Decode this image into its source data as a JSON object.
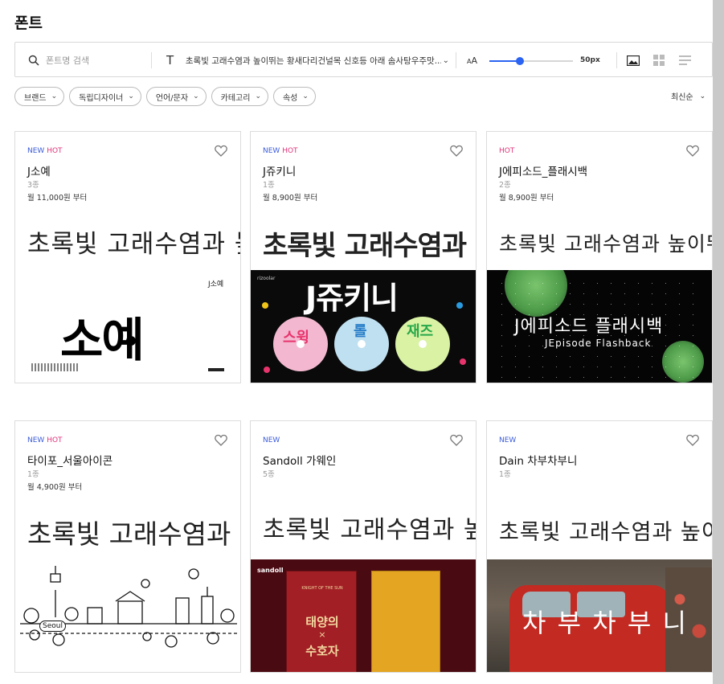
{
  "page": {
    "title": "폰트"
  },
  "search": {
    "placeholder": "폰트명 검색",
    "sample_text": "초록빛 고래수염과 높이뛰는 황새다리건널목 신호등 아래 솜사탕우주맛...",
    "size_label_big": "A",
    "size_label_small": "A",
    "size_value": "50px",
    "size_fraction": 0.37
  },
  "filters": [
    "브랜드",
    "독립디자이너",
    "언어/문자",
    "카테고리",
    "속성"
  ],
  "sort": {
    "label": "최신순"
  },
  "cards": [
    {
      "new": "NEW",
      "hot": "HOT",
      "name": "J소예",
      "count": "3종",
      "price": "월 11,000원 부터",
      "sample": "초록빛 고래수염과 높이뛰",
      "preview_title": "J소예",
      "preview_logo": "소예"
    },
    {
      "new": "NEW",
      "hot": "HOT",
      "name": "J쥬키니",
      "count": "1종",
      "price": "월 8,900원 부터",
      "sample": "초록빛 고래수염과",
      "preview_title": "J쥬키니",
      "preview_small": "rizoolar",
      "preview_labels": [
        "스윙",
        "롤",
        "재즈"
      ]
    },
    {
      "new": "",
      "hot": "HOT",
      "name": "J에피소드_플래시백",
      "count": "2종",
      "price": "월 8,900원 부터",
      "sample": "초록빛 고래수염과 높이뛰",
      "preview_title": "J에피소드 플래시백",
      "preview_sub": "JEpisode Flashback"
    },
    {
      "new": "NEW",
      "hot": "HOT",
      "name": "타이포_서울아이콘",
      "count": "1종",
      "price": "월 4,900원 부터",
      "sample": "초록빛 고래수염과 높이",
      "preview_label": "Seoul"
    },
    {
      "new": "NEW",
      "hot": "",
      "name": "Sandoll 가웨인",
      "count": "5종",
      "price": "",
      "sample": "초록빛 고래수염과 높이뛰",
      "preview_brand": "sandoll",
      "preview_book_small": "KNIGHT OF THE SUN",
      "preview_book1": "태양의",
      "preview_book_x": "×",
      "preview_book2": "수호자"
    },
    {
      "new": "NEW",
      "hot": "",
      "name": "Dain 차부차부니",
      "count": "1종",
      "price": "",
      "sample": "초록빛 고래수염과 높이뛰",
      "preview_title": "차 부 차 부 니"
    }
  ]
}
